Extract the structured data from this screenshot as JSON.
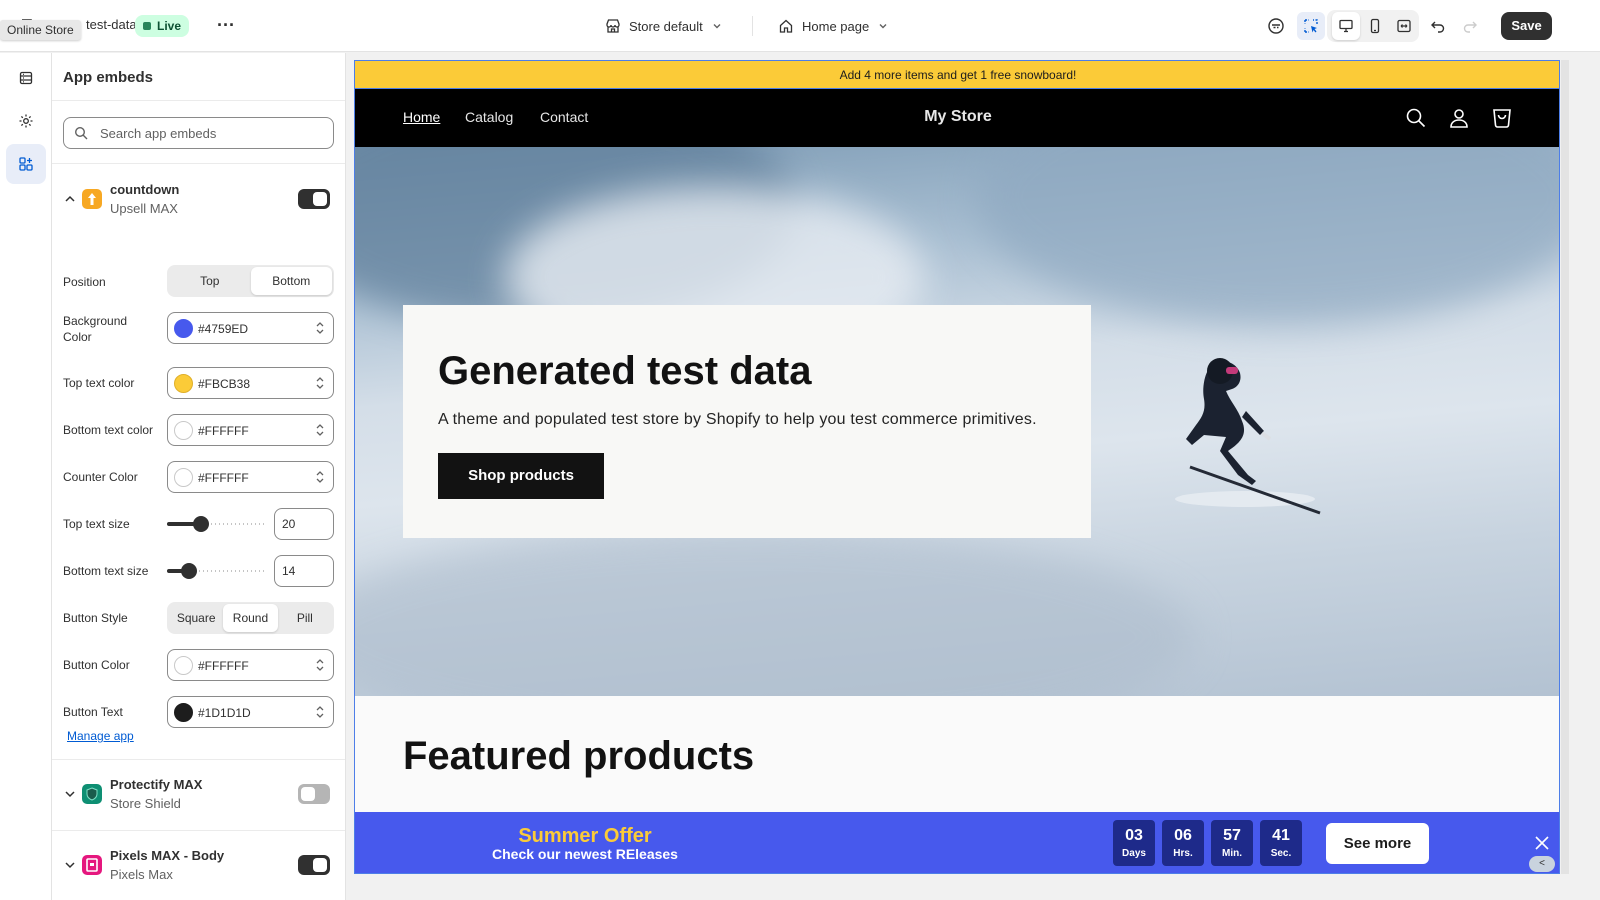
{
  "topbar": {
    "theme_name": "test-data",
    "live_badge": "Live",
    "tooltip": "Online Store",
    "template_select": "Store default",
    "page_select": "Home page",
    "save_label": "Save"
  },
  "panel": {
    "title": "App embeds",
    "search_placeholder": "Search app embeds",
    "manage_link": "Manage app",
    "embeds": [
      {
        "name": "countdown",
        "sub": "Upsell MAX",
        "enabled": true,
        "expanded": true,
        "icon_color": "#f7a823"
      },
      {
        "name": "Protectify MAX",
        "sub": "Store Shield",
        "enabled": false,
        "expanded": false,
        "icon_color": "#0e8f73"
      },
      {
        "name": "Pixels MAX - Body",
        "sub": "Pixels Max",
        "enabled": true,
        "expanded": false,
        "icon_color": "#e5177e"
      }
    ],
    "settings": {
      "position_label": "Position",
      "position_options": [
        "Top",
        "Bottom"
      ],
      "position_selected": "Bottom",
      "bg_color_label": "Background Color",
      "bg_color": "#4759ED",
      "top_text_color_label": "Top text color",
      "top_text_color": "#FBCB38",
      "bottom_text_color_label": "Bottom text color",
      "bottom_text_color": "#FFFFFF",
      "counter_color_label": "Counter Color",
      "counter_color": "#FFFFFF",
      "top_text_size_label": "Top text size",
      "top_text_size": "20",
      "bottom_text_size_label": "Bottom text size",
      "bottom_text_size": "14",
      "button_style_label": "Button Style",
      "button_style_options": [
        "Square",
        "Round",
        "Pill"
      ],
      "button_style_selected": "Round",
      "button_color_label": "Button Color",
      "button_color": "#FFFFFF",
      "button_text_label": "Button Text",
      "button_text_color": "#1D1D1D"
    }
  },
  "store": {
    "announcement": "Add 4 more items and get 1 free snowboard!",
    "nav": [
      "Home",
      "Catalog",
      "Contact"
    ],
    "brand": "My Store",
    "hero_title": "Generated test data",
    "hero_subtitle": "A theme and populated test store by Shopify to help you test commerce primitives.",
    "hero_button": "Shop products",
    "featured_title": "Featured products"
  },
  "countdown": {
    "top_text": "Summer Offer",
    "bottom_text": "Check our newest REleases",
    "units": [
      {
        "value": "03",
        "label": "Days"
      },
      {
        "value": "06",
        "label": "Hrs."
      },
      {
        "value": "57",
        "label": "Min."
      },
      {
        "value": "41",
        "label": "Sec."
      }
    ],
    "button": "See more",
    "collapse": "<"
  },
  "colors": {
    "accent": "#4759ED",
    "top_text": "#FBCB38",
    "announcement_bg": "#FBCB38",
    "live_green": "#29845A"
  }
}
